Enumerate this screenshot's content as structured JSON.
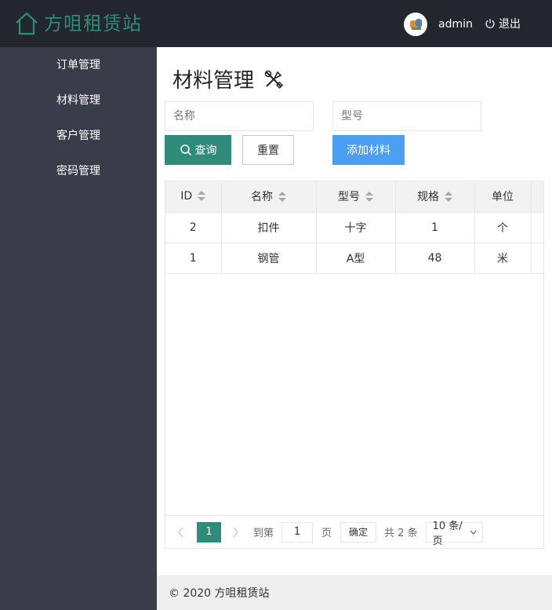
{
  "header": {
    "brand": "方咀租赁站",
    "user": {
      "name": "admin"
    },
    "logout_label": "退出"
  },
  "sidebar": {
    "items": [
      {
        "label": "订单管理"
      },
      {
        "label": "材料管理"
      },
      {
        "label": "客户管理"
      },
      {
        "label": "密码管理"
      }
    ]
  },
  "page": {
    "title": "材料管理",
    "icons": {
      "title": "tools-icon",
      "search": "search-icon",
      "logo": "home-icon",
      "logout": "power-icon"
    }
  },
  "filters": {
    "name_placeholder": "名称",
    "model_placeholder": "型号"
  },
  "buttons": {
    "query": "查询",
    "reset": "重置",
    "add": "添加材料"
  },
  "table": {
    "columns": [
      "ID",
      "名称",
      "型号",
      "规格",
      "单位"
    ],
    "rows": [
      [
        "2",
        "扣件",
        "十字",
        "1",
        "个"
      ],
      [
        "1",
        "钢管",
        "A型",
        "48",
        "米"
      ]
    ]
  },
  "pagination": {
    "current_page": "1",
    "goto_label": "到第",
    "goto_value": "1",
    "page_label": "页",
    "confirm_label": "确定",
    "total_label": "共 2 条",
    "page_size": "10 条/页"
  },
  "footer": {
    "text": "© 2020 方咀租赁站"
  },
  "colors": {
    "header_bg": "#23262e",
    "sidebar_bg": "#393d49",
    "brand": "#2f8c7b",
    "primary_button": "#2f8c7b",
    "add_button": "#4c9ef0"
  }
}
